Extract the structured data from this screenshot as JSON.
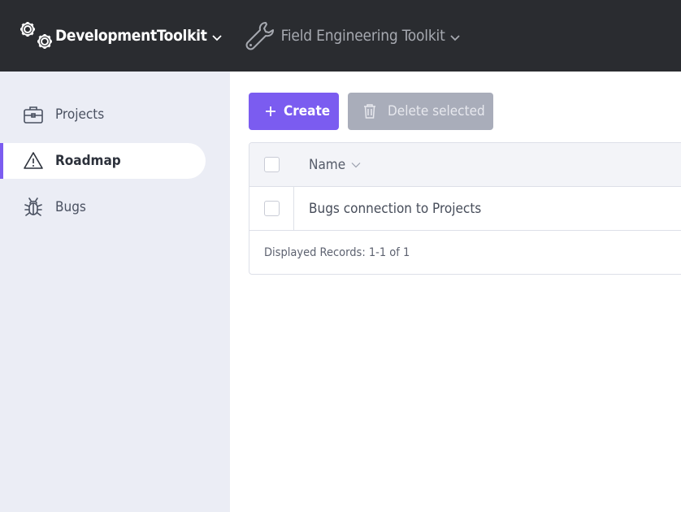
{
  "topbar": {
    "primary_app": {
      "label": "DevelopmentToolkit",
      "icon": "gears-icon"
    },
    "secondary_app": {
      "label": "Field Engineering Toolkit",
      "icon": "wrench-icon"
    }
  },
  "sidebar": {
    "items": [
      {
        "label": "Projects",
        "icon": "briefcase-icon",
        "active": false
      },
      {
        "label": "Roadmap",
        "icon": "warning-triangle-icon",
        "active": true
      },
      {
        "label": "Bugs",
        "icon": "bug-icon",
        "active": false
      }
    ]
  },
  "toolbar": {
    "create_label": "Create",
    "delete_label": "Delete selected"
  },
  "table": {
    "columns": [
      {
        "label": "Name",
        "sortable": true
      }
    ],
    "rows": [
      {
        "name": "Bugs connection to Projects"
      }
    ],
    "footer": "Displayed Records: 1-1 of 1"
  },
  "colors": {
    "topbar_bg": "#2a2c30",
    "sidebar_bg": "#ebedf5",
    "accent": "#7b5cf0",
    "disabled_button": "#a9adba"
  }
}
